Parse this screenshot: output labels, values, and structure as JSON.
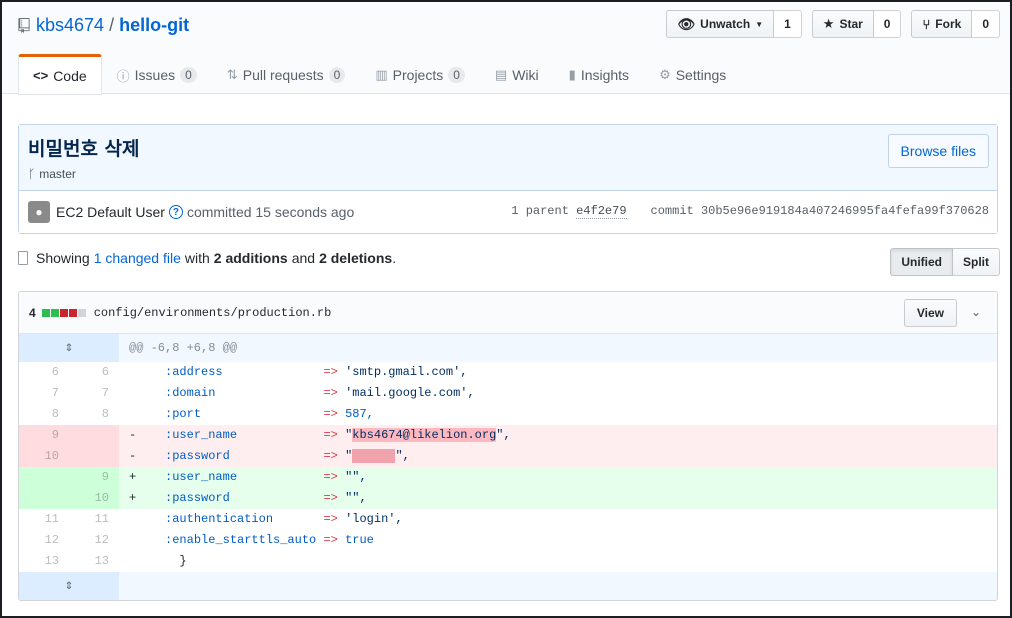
{
  "repo": {
    "owner": "kbs4674",
    "separator": "/",
    "name": "hello-git"
  },
  "actions": {
    "watch": {
      "label": "Unwatch",
      "count": "1"
    },
    "star": {
      "label": "Star",
      "count": "0"
    },
    "fork": {
      "label": "Fork",
      "count": "0"
    }
  },
  "nav": {
    "code": "Code",
    "issues": {
      "label": "Issues",
      "count": "0"
    },
    "pulls": {
      "label": "Pull requests",
      "count": "0"
    },
    "projects": {
      "label": "Projects",
      "count": "0"
    },
    "wiki": "Wiki",
    "insights": "Insights",
    "settings": "Settings"
  },
  "commit": {
    "title": "비밀번호 삭제",
    "branch": "master",
    "browse_label": "Browse files",
    "author": "EC2 Default User",
    "time_text": "committed 15 seconds ago",
    "parent_label": "1 parent",
    "parent_sha": "e4f2e79",
    "commit_label": "commit",
    "commit_sha": "30b5e96e919184a407246995fa4fefa99f370628"
  },
  "toc": {
    "showing": "Showing",
    "changed": "1 changed file",
    "with": "with",
    "additions": "2 additions",
    "and": "and",
    "deletions": "2 deletions",
    "period": "."
  },
  "view_mode": {
    "unified": "Unified",
    "split": "Split"
  },
  "file": {
    "diffstat": "4",
    "path": "config/environments/production.rb",
    "view_label": "View",
    "hunk": "@@ -6,8 +6,8 @@",
    "lines": [
      {
        "type": "ctx",
        "old": "6",
        "new": "6",
        "sign": " ",
        "key": ":address",
        "arrow": "=>",
        "value": "'smtp.gmail.com',"
      },
      {
        "type": "ctx",
        "old": "7",
        "new": "7",
        "sign": " ",
        "key": ":domain",
        "arrow": "=>",
        "value": "'mail.google.com',"
      },
      {
        "type": "ctx",
        "old": "8",
        "new": "8",
        "sign": " ",
        "key": ":port",
        "arrow": "=>",
        "value": "587,"
      },
      {
        "type": "del",
        "old": "9",
        "new": "",
        "sign": "-",
        "key": ":user_name",
        "arrow": "=>",
        "value": "\"kbs4674@likelion.org\","
      },
      {
        "type": "del",
        "old": "10",
        "new": "",
        "sign": "-",
        "key": ":password",
        "arrow": "=>",
        "value": "\"██████\","
      },
      {
        "type": "add",
        "old": "",
        "new": "9",
        "sign": "+",
        "key": ":user_name",
        "arrow": "=>",
        "value": "\"\","
      },
      {
        "type": "add",
        "old": "",
        "new": "10",
        "sign": "+",
        "key": ":password",
        "arrow": "=>",
        "value": "\"\","
      },
      {
        "type": "ctx",
        "old": "11",
        "new": "11",
        "sign": " ",
        "key": ":authentication",
        "arrow": "=>",
        "value": "'login',"
      },
      {
        "type": "ctx",
        "old": "12",
        "new": "12",
        "sign": " ",
        "key": ":enable_starttls_auto",
        "arrow": "=>",
        "value": "true"
      },
      {
        "type": "ctx",
        "old": "13",
        "new": "13",
        "sign": " ",
        "key": "}",
        "arrow": "",
        "value": ""
      }
    ]
  },
  "colors": {
    "link": "#0366d6",
    "addition": "#2cbe4e",
    "deletion": "#cb2431",
    "accent_tab": "#e36209"
  }
}
